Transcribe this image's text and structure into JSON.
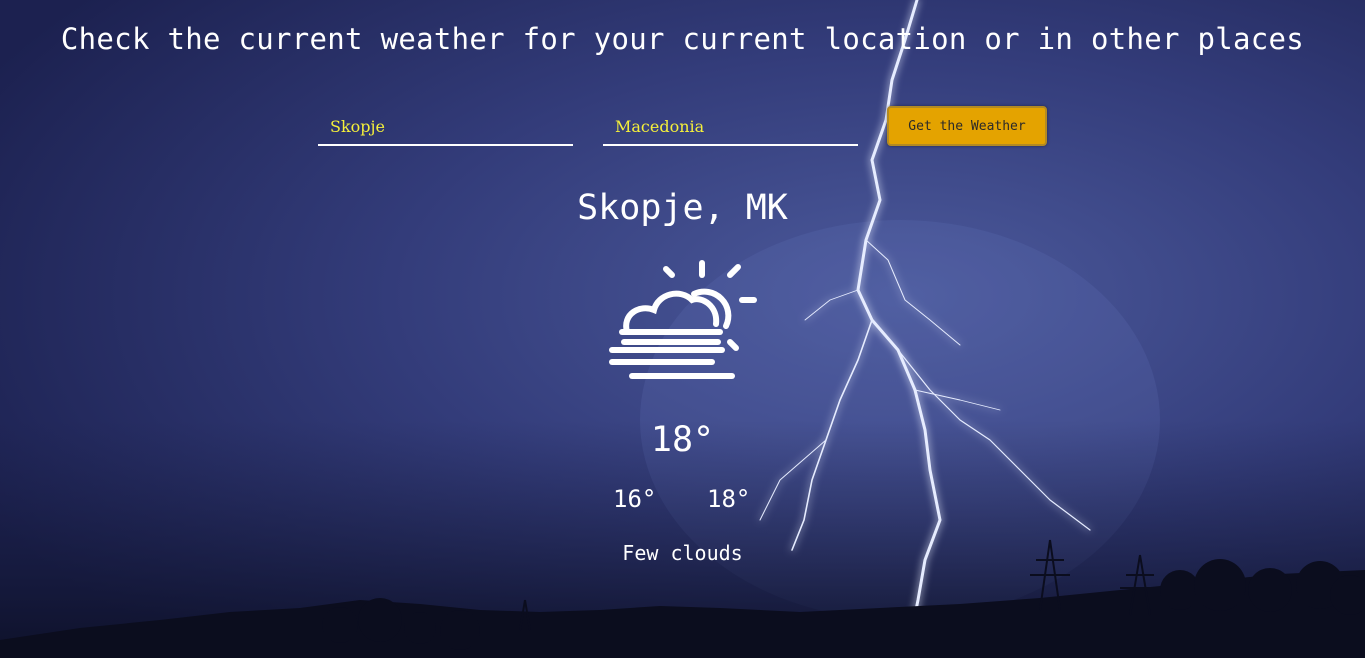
{
  "header": {
    "title": "Check the current weather for your current location or in other places"
  },
  "form": {
    "city_value": "Skopje",
    "country_value": "Macedonia",
    "submit_label": "Get the Weather"
  },
  "weather": {
    "location": "Skopje, MK",
    "icon": "partly-cloudy-fog-icon",
    "temperature": "18°",
    "temp_min": "16°",
    "temp_max": "18°",
    "description": "Few clouds"
  },
  "colors": {
    "accent_button": "#e4a300",
    "input_text": "#f5f03a",
    "text": "#ffffff"
  }
}
